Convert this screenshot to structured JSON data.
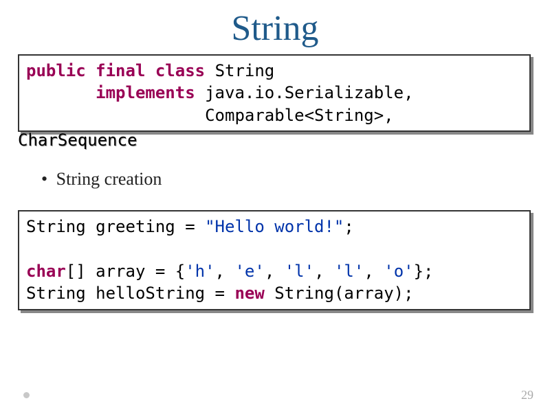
{
  "title": "String",
  "code1": {
    "public": "public",
    "final": "final",
    "class": "class",
    "name": "String",
    "implements": "implements",
    "iface1": "java.io.Serializable,",
    "iface2": "Comparable<String>,"
  },
  "overflow": "CharSequence",
  "bullet": "String creation",
  "code2": {
    "l1a": "String greeting = ",
    "l1b": "\"Hello world!\"",
    "l1c": ";",
    "l2a": "char",
    "l2b": "[] array = {",
    "c1": "'h'",
    "c2": "'e'",
    "c3": "'l'",
    "c4": "'l'",
    "c5": "'o'",
    "l2c": "};",
    "l3a": "String helloString = ",
    "l3b": "new",
    "l3c": " String(array);"
  },
  "pageNumber": "29"
}
